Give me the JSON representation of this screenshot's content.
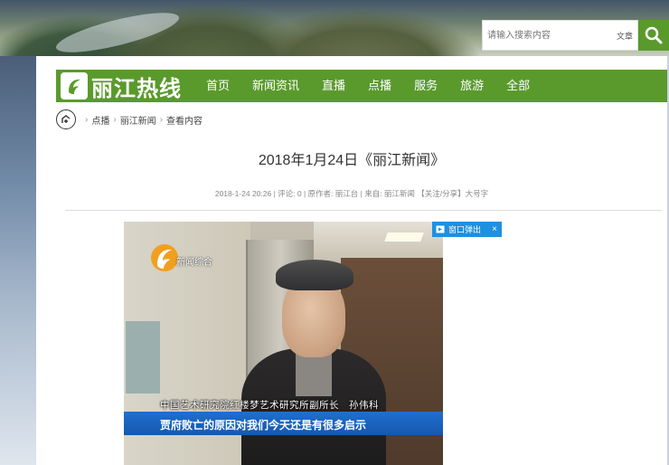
{
  "search": {
    "placeholder": "请输入搜索内容",
    "type_label": "文章"
  },
  "site": {
    "logo_text": "丽江热线"
  },
  "nav": {
    "items": [
      "首页",
      "新闻资讯",
      "直播",
      "点播",
      "服务",
      "旅游",
      "全部"
    ]
  },
  "breadcrumb": {
    "items": [
      "点播",
      "丽江新闻",
      "查看内容"
    ]
  },
  "article": {
    "title": "2018年1月24日《丽江新闻》",
    "meta": "2018-1-24 20:26 | 评论: 0 | 原作者: 丽江台 | 来自: 丽江新闻 【关注/分享】大号字"
  },
  "video": {
    "channel_label": "新闻综合",
    "caption_name": "中国艺术研究院红楼梦艺术研究所副所长　孙伟科",
    "caption_quote": "贾府败亡的原因对我们今天还是有很多启示",
    "popout_label": "窗口弹出",
    "close_label": "×"
  },
  "colors": {
    "brand_green": "#5a9a2c",
    "popout_blue": "#1e90e0",
    "caption_blue": "#1f6fcf"
  }
}
